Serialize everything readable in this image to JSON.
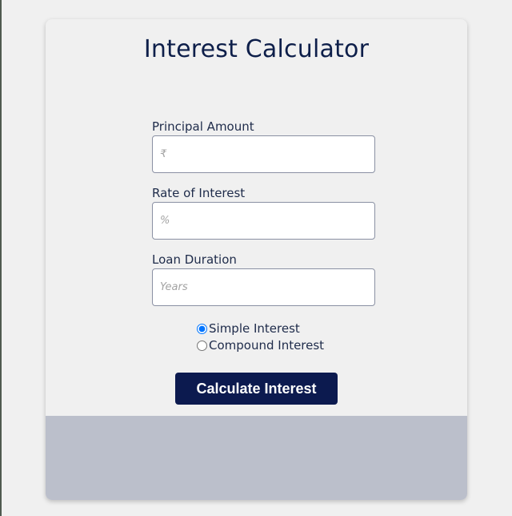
{
  "title": "Interest Calculator",
  "fields": {
    "principal": {
      "label": "Principal Amount",
      "placeholder": "₹",
      "value": ""
    },
    "rate": {
      "label": "Rate of Interest",
      "placeholder": "%",
      "value": ""
    },
    "duration": {
      "label": "Loan Duration",
      "placeholder": "Years",
      "value": ""
    }
  },
  "interest_type": {
    "options": [
      {
        "label": "Simple Interest",
        "selected": true
      },
      {
        "label": "Compound Interest",
        "selected": false
      }
    ]
  },
  "calculate_button_label": "Calculate Interest",
  "result_text": "",
  "colors": {
    "accent": "#0c1a4f",
    "title": "#0e1f4a",
    "result_panel": "#bbbfcb",
    "background": "#f0f0f0"
  }
}
